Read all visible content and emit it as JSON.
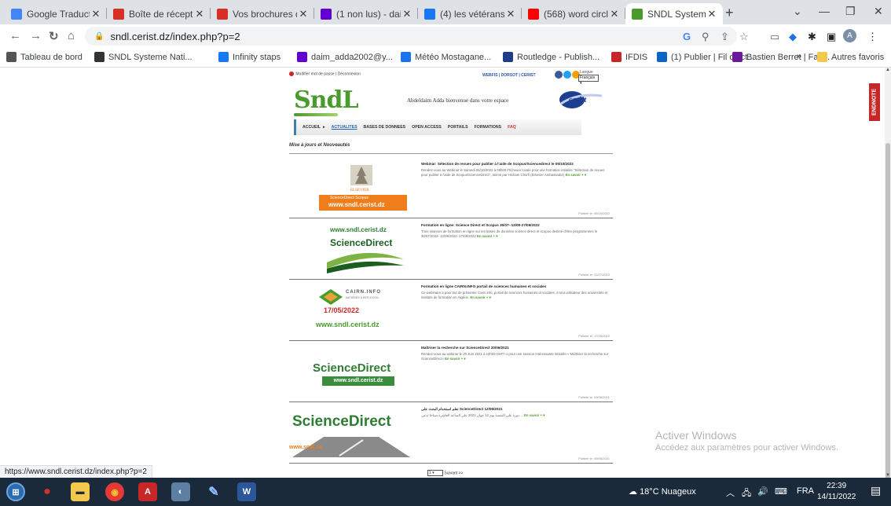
{
  "browser": {
    "tabs": [
      {
        "label": "Google Traductio",
        "icon": "google-translate-icon",
        "color": "#4285f4"
      },
      {
        "label": "Boîte de réceptio",
        "icon": "gmail-icon",
        "color": "#d93025"
      },
      {
        "label": "Vos brochures d",
        "icon": "gmail-icon",
        "color": "#d93025"
      },
      {
        "label": "(1 non lus) - dain",
        "icon": "yahoo-mail-icon",
        "color": "#6001d2"
      },
      {
        "label": "(4) les vétérans c",
        "icon": "facebook-icon",
        "color": "#1877f2"
      },
      {
        "label": "(568) word circle",
        "icon": "youtube-icon",
        "color": "#ff0000"
      },
      {
        "label": "SNDL Systeme N",
        "icon": "sndl-icon",
        "color": "#4a9b2e"
      }
    ],
    "url": "sndl.cerist.dz/index.php?p=2",
    "profile_initial": "A",
    "bookmarks": [
      {
        "label": "Tableau de bord",
        "icon": "dashboard-icon",
        "color": "#555555"
      },
      {
        "label": "SNDL Systeme Nati...",
        "icon": "globe-icon",
        "color": "#333333"
      },
      {
        "label": "Infinity staps",
        "icon": "facebook-icon",
        "color": "#1877f2"
      },
      {
        "label": "daim_adda2002@y...",
        "icon": "yahoo-icon",
        "color": "#6001d2"
      },
      {
        "label": "Météo Mostagane...",
        "icon": "weather-icon",
        "color": "#1a73e8"
      },
      {
        "label": "Routledge - Publish...",
        "icon": "routledge-icon",
        "color": "#1f3c88"
      },
      {
        "label": "IFDIS",
        "icon": "ifdis-icon",
        "color": "#c62828"
      },
      {
        "label": "(1) Publier | Fil d'act...",
        "icon": "linkedin-icon",
        "color": "#0a66c2"
      },
      {
        "label": "Bastien Berret | Fac...",
        "icon": "univ-icon",
        "color": "#6a1b9a"
      }
    ],
    "more_bookmarks": "»",
    "other_favorites": "Autres favoris",
    "status_url": "https://www.sndl.cerist.dz/index.php?p=2"
  },
  "site": {
    "top_left": "Modifier mot de passe | Déconnexion",
    "top_links": "WEBFIS | DORSOT | CERIST",
    "lang_label": "Langue",
    "lang_value": "Français",
    "logo_text": "SndL",
    "welcome": "Abdeldaim Adda bienvenue dans votre espace",
    "cerist_logo": "cerist",
    "nav": [
      "ACCUEIL",
      "ACTUALITES",
      "BASES DE DONNEES",
      "OPEN ACCESS",
      "PORTAILS",
      "FORMATIONS",
      "FAQ"
    ],
    "section_title": "Mise à jours et Nouveautés",
    "news": [
      {
        "title": "Webinar: Sélection de revues pour publier à l'aide de Scopus/Sciencedirect le 05/10/2022",
        "text": "Rendez-vous au Webinar le Samedi 05/10/2022 à 09h00 FN heure locale pour une formation intitulée \"Sélection de revues pour publier à l'aide de Scopus/ScienceDirect\", animé par Hicham Chorfi (Elsevier Ambassador)",
        "more": "En savoir +",
        "date": "Publiée le: 05/10/2022",
        "thumb": "elsevier",
        "thumb_caption": "ScienceDirect    Scopus",
        "thumb_url": "www.sndl.cerist.dz"
      },
      {
        "title": "Formation en ligne: Science Direct et Scopus 30/07--13/09-27/09/2022",
        "text": "Trois séances de formation en ligne sur les bases de données science direct et scopus destiné d'être programmées le 30/07/2022- 13/09/2022- 27/09/2022",
        "more": "En savoir +",
        "date": "Publiée le: 21/07/2022",
        "thumb": "sciencedirect-green",
        "thumb_url": "www.sndl.cerist.dz",
        "thumb_caption": "ScienceDirect"
      },
      {
        "title": "Formation en ligne CAIRN.INFO portail de sciences humaines et sociales",
        "text": "Ce webinaire a pour but de présenter Cairn.info, portail de sciences humaines et sociales, à tout utilisateur des universités et instituts de formation en Algérie.",
        "more": "En savoir +",
        "date": "Publiée le: 17/05/2022",
        "thumb": "cairn",
        "thumb_brand": "CAIRN.INFO",
        "thumb_sub": "MATIÈRES À RÉFLEXION",
        "thumb_date": "17/05/2022",
        "thumb_url": "www.sndl.cerist.dz"
      },
      {
        "title": "Maîtriser la recherche sur ScienceDirect 20/06/2021",
        "text": "Rendez-vous au webinar le 20 Juin 2021 à 10h00 GMT+1 pour une session intéressante intitulée « Maîtriser la recherche sur ScienceDirect»",
        "more": "En savoir +",
        "date": "Publiée le: 09/06/2021",
        "thumb": "sciencedirect-bar",
        "thumb_caption": "ScienceDirect",
        "thumb_url": "www.sndl.cerist.dz"
      },
      {
        "title": "12/06/2021 ScienceDirect تعلم استخدام البحث على",
        "text": "دورة على المنصة يوم 12 جوان 2021 على الساعة العاشرة صباحا تدعى ...",
        "more": "En savoir +",
        "date": "Publiée le: 09/06/2021",
        "thumb": "sciencedirect-large",
        "thumb_caption": "ScienceDirect",
        "thumb_url": "www.sndl.ce"
      }
    ],
    "pager_value": "1",
    "pager_next": "Suivant >>",
    "endnote": "ENDNOTE"
  },
  "activation": {
    "title": "Activer Windows",
    "subtitle": "Accédez aux paramètres pour activer Windows."
  },
  "taskbar": {
    "weather": "18°C  Nuageux",
    "language": "FRA",
    "time": "22:39",
    "date": "14/11/2022"
  }
}
